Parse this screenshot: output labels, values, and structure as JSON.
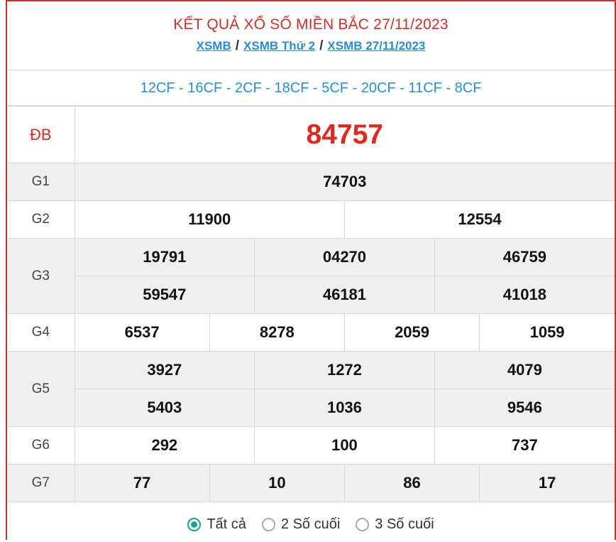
{
  "header": {
    "title": "KẾT QUẢ XỔ SỐ MIỀN BẮC 27/11/2023",
    "breadcrumbs": [
      "XSMB",
      "XSMB Thứ 2",
      "XSMB 27/11/2023"
    ],
    "separator": "/"
  },
  "codes": "12CF - 16CF - 2CF - 18CF - 5CF - 20CF - 11CF - 8CF",
  "prizes": {
    "db": {
      "label": "ĐB",
      "values": [
        "84757"
      ]
    },
    "g1": {
      "label": "G1",
      "values": [
        "74703"
      ]
    },
    "g2": {
      "label": "G2",
      "values": [
        "11900",
        "12554"
      ]
    },
    "g3": {
      "label": "G3",
      "values": [
        "19791",
        "04270",
        "46759",
        "59547",
        "46181",
        "41018"
      ]
    },
    "g4": {
      "label": "G4",
      "values": [
        "6537",
        "8278",
        "2059",
        "1059"
      ]
    },
    "g5": {
      "label": "G5",
      "values": [
        "3927",
        "1272",
        "4079",
        "5403",
        "1036",
        "9546"
      ]
    },
    "g6": {
      "label": "G6",
      "values": [
        "292",
        "100",
        "737"
      ]
    },
    "g7": {
      "label": "G7",
      "values": [
        "77",
        "10",
        "86",
        "17"
      ]
    }
  },
  "options": {
    "items": [
      "Tất cả",
      "2 Số cuối",
      "3 Số cuối"
    ],
    "selected": "Tất cả"
  },
  "colors": {
    "accent_red": "#e0281f",
    "link_blue": "#2b8cd6",
    "radio_green": "#1aa38a"
  }
}
